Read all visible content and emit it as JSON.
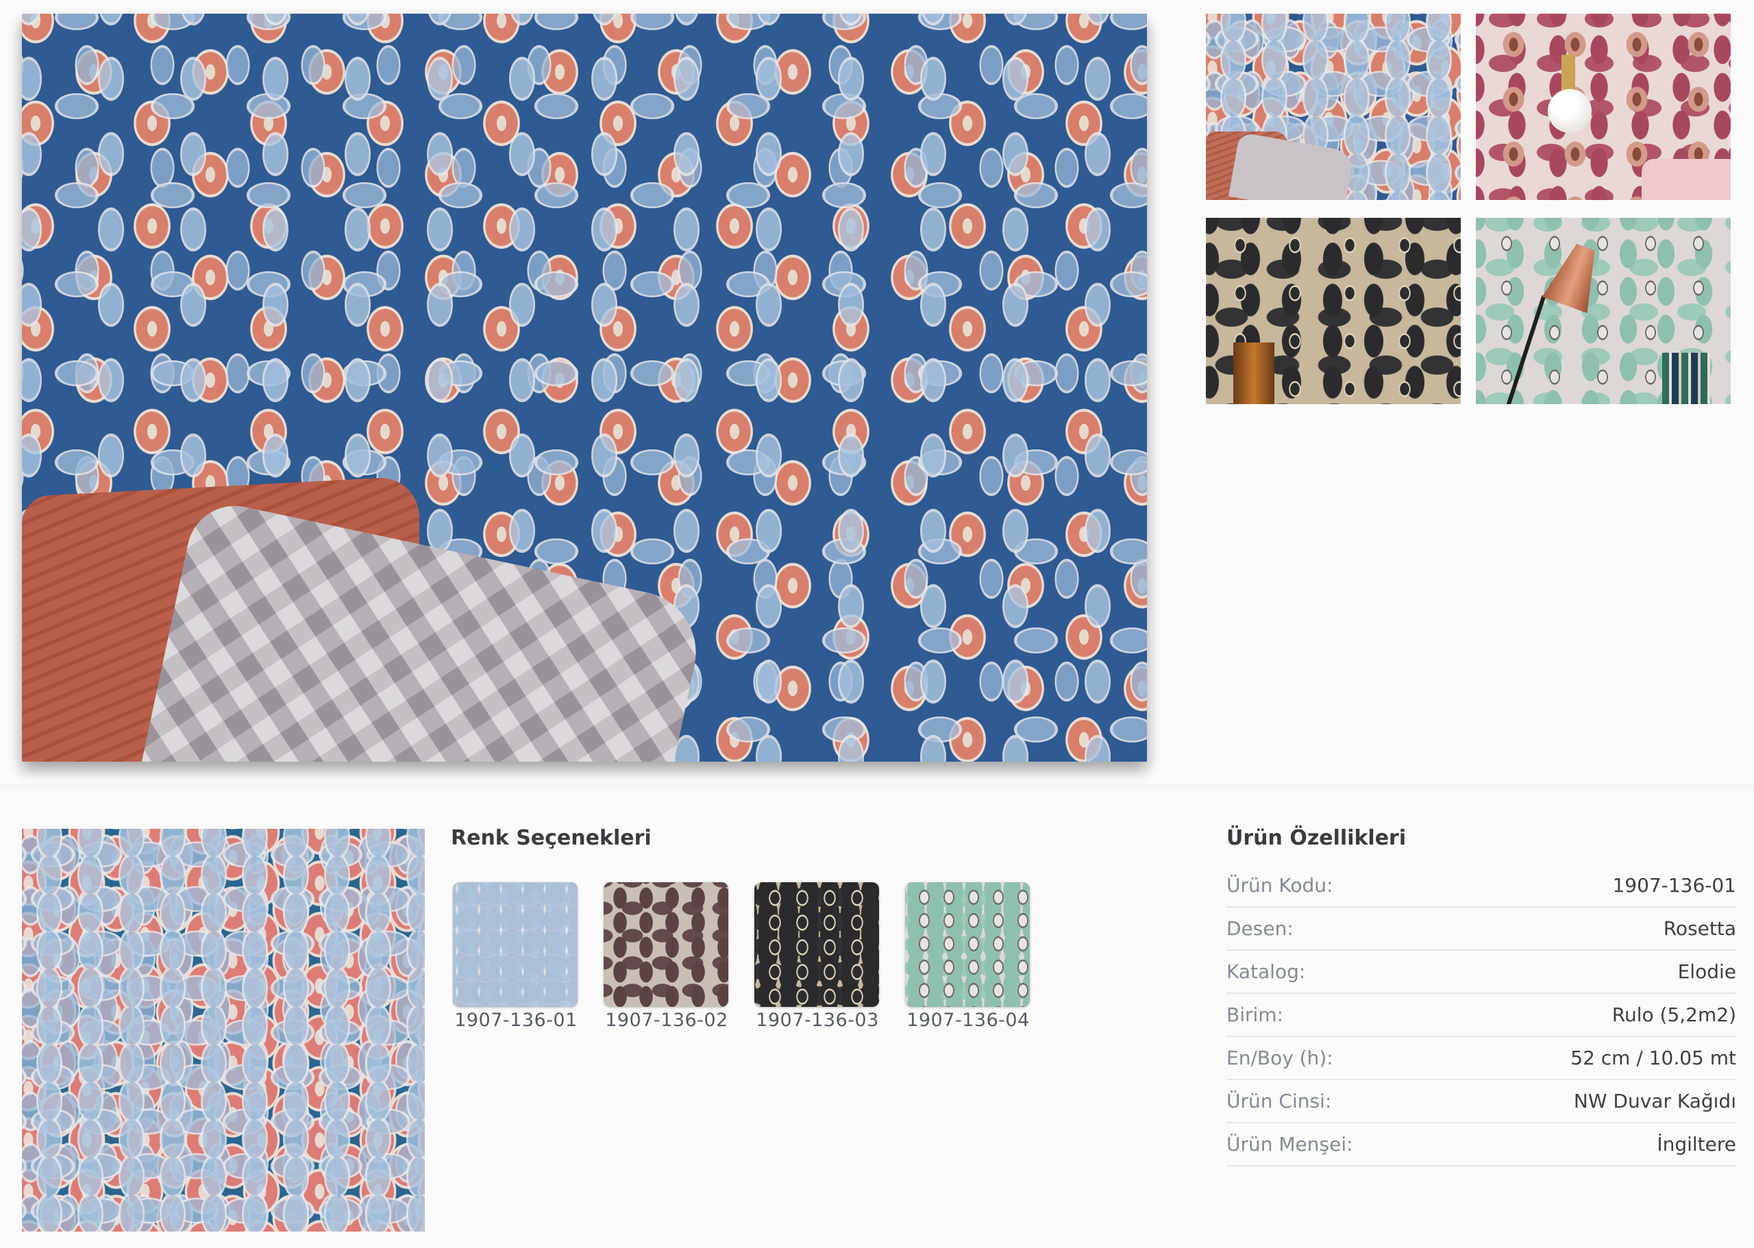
{
  "gallery": {
    "thumbnails": [
      {
        "name": "blue-room"
      },
      {
        "name": "pink-room"
      },
      {
        "name": "dark-room"
      },
      {
        "name": "mint-room"
      }
    ]
  },
  "color_options": {
    "title": "Renk Seçenekleri",
    "items": [
      {
        "code": "1907-136-01",
        "color": "#2f5a92"
      },
      {
        "code": "1907-136-02",
        "color": "#5b4244"
      },
      {
        "code": "1907-136-03",
        "color": "#2b2b2d"
      },
      {
        "code": "1907-136-04",
        "color": "#8fbfae"
      }
    ]
  },
  "product_properties": {
    "title": "Ürün Özellikleri",
    "rows": [
      {
        "label": "Ürün Kodu:",
        "value": "1907-136-01"
      },
      {
        "label": "Desen:",
        "value": "Rosetta"
      },
      {
        "label": "Katalog:",
        "value": "Elodie"
      },
      {
        "label": "Birim:",
        "value": "Rulo (5,2m2)"
      },
      {
        "label": "En/Boy (h):",
        "value": "52 cm / 10.05 mt"
      },
      {
        "label": "Ürün Cinsi:",
        "value": "NW Duvar Kağıdı"
      },
      {
        "label": "Ürün Menşei:",
        "value": "İngiltere"
      }
    ]
  }
}
